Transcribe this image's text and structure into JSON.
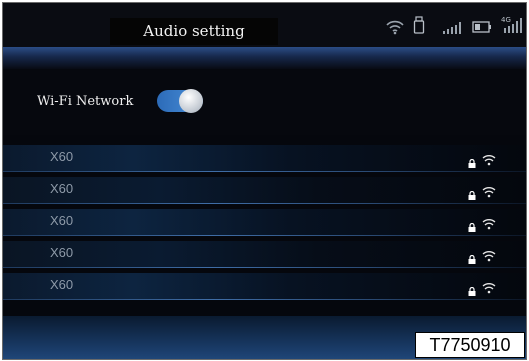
{
  "header": {
    "title": "Audio setting"
  },
  "status_icons": [
    "wifi-icon",
    "usb-icon",
    "signal-icon",
    "battery-icon",
    "4g-signal-icon"
  ],
  "status_4g_label": "4G",
  "wifi": {
    "label": "Wi-Fi Network",
    "enabled": true
  },
  "networks": [
    {
      "name": "X60",
      "locked": true
    },
    {
      "name": "X60",
      "locked": true
    },
    {
      "name": "X60",
      "locked": true
    },
    {
      "name": "X60",
      "locked": true
    },
    {
      "name": "X60",
      "locked": true
    }
  ],
  "figure_code": "T7750910",
  "colors": {
    "accent": "#3a7bd5",
    "background": "#05070d",
    "text": "#f0f0f0",
    "list_text": "#8e9aa8"
  }
}
